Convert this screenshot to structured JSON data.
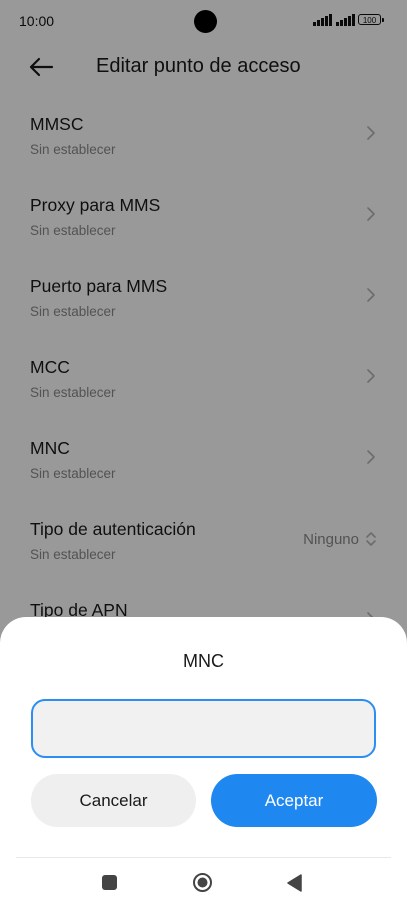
{
  "status": {
    "time": "10:00",
    "battery": "100"
  },
  "header": {
    "title": "Editar punto de acceso"
  },
  "list": [
    {
      "title": "MMSC",
      "subtitle": "Sin establecer"
    },
    {
      "title": "Proxy para MMS",
      "subtitle": "Sin establecer"
    },
    {
      "title": "Puerto para MMS",
      "subtitle": "Sin establecer"
    },
    {
      "title": "MCC",
      "subtitle": "Sin establecer"
    },
    {
      "title": "MNC",
      "subtitle": "Sin establecer"
    },
    {
      "title": "Tipo de autenticación",
      "subtitle": "Sin establecer",
      "value": "Ninguno"
    },
    {
      "title": "Tipo de APN"
    }
  ],
  "dialog": {
    "title": "MNC",
    "input_value": "",
    "cancel_label": "Cancelar",
    "ok_label": "Aceptar"
  },
  "colors": {
    "accent": "#1e87f0",
    "input_border": "#2b8ef2"
  }
}
